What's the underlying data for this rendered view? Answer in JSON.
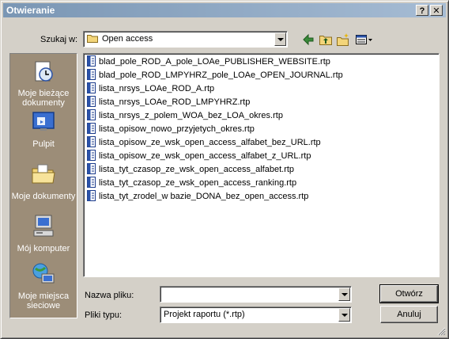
{
  "window": {
    "title": "Otwieranie"
  },
  "titlebar": {
    "help_label": "?",
    "close_label": "✕"
  },
  "lookin": {
    "label": "Szukaj w:",
    "value": "Open access"
  },
  "toolbar": {
    "back_icon": "back-arrow-icon",
    "up_icon": "up-folder-icon",
    "newfolder_icon": "new-folder-icon",
    "views_icon": "views-menu-icon"
  },
  "places": [
    {
      "label": "Moje bieżące dokumenty",
      "icon": "recent-documents-icon"
    },
    {
      "label": "Pulpit",
      "icon": "desktop-icon"
    },
    {
      "label": "Moje dokumenty",
      "icon": "my-documents-icon"
    },
    {
      "label": "Mój komputer",
      "icon": "my-computer-icon"
    },
    {
      "label": "Moje miejsca sieciowe",
      "icon": "network-places-icon"
    }
  ],
  "files": [
    "blad_pole_ROD_A_pole_LOAe_PUBLISHER_WEBSITE.rtp",
    "blad_pole_ROD_LMPYHRZ_pole_LOAe_OPEN_JOURNAL.rtp",
    "lista_nrsys_LOAe_ROD_A.rtp",
    "lista_nrsys_LOAe_ROD_LMPYHRZ.rtp",
    "lista_nrsys_z_polem_WOA_bez_LOA_okres.rtp",
    "lista_opisow_nowo_przyjetych_okres.rtp",
    "lista_opisow_ze_wsk_open_access_alfabet_bez_URL.rtp",
    "lista_opisow_ze_wsk_open_access_alfabet_z_URL.rtp",
    "lista_tyt_czasop_ze_wsk_open_access_alfabet.rtp",
    "lista_tyt_czasop_ze_wsk_open_access_ranking.rtp",
    "lista_tyt_zrodel_w bazie_DONA_bez_open_access.rtp"
  ],
  "filename": {
    "label": "Nazwa pliku:",
    "value": ""
  },
  "filetype": {
    "label": "Pliki typu:",
    "value": "Projekt raportu (*.rtp)"
  },
  "buttons": {
    "open_label": "Otwórz",
    "cancel_label": "Anuluj"
  }
}
